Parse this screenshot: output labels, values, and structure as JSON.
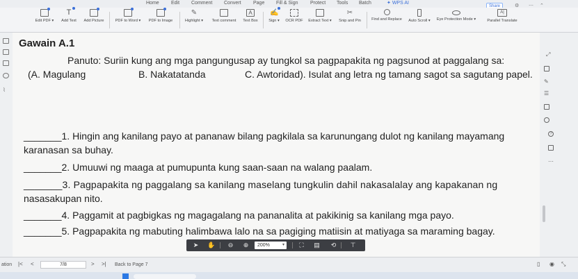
{
  "menu": {
    "tabs": [
      "Home",
      "Edit",
      "Comment",
      "Convert",
      "Page",
      "Fill & Sign",
      "Protect",
      "Tools",
      "Batch",
      "WPS AI"
    ],
    "share_label": "Share"
  },
  "ribbon": {
    "tools": [
      {
        "label": "Edit PDF ▾",
        "icon": "edit-pdf-icon"
      },
      {
        "label": "Add Text",
        "icon": "add-text-icon"
      },
      {
        "label": "Add Picture",
        "icon": "add-picture-icon"
      },
      {
        "label": "PDF to Word ▾",
        "icon": "pdf-to-word-icon"
      },
      {
        "label": "PDF to Image",
        "icon": "pdf-to-image-icon"
      },
      {
        "label": "Highlight ▾",
        "icon": "highlight-icon"
      },
      {
        "label": "Text comment",
        "icon": "text-comment-icon"
      },
      {
        "label": "Text Box",
        "icon": "text-box-icon"
      },
      {
        "label": "Sign ▾",
        "icon": "sign-icon"
      },
      {
        "label": "OCR PDF",
        "icon": "ocr-icon"
      },
      {
        "label": "Extract Text ▾",
        "icon": "extract-text-icon"
      },
      {
        "label": "Snip and Pin",
        "icon": "snip-icon"
      },
      {
        "label": "Find and Replace",
        "icon": "find-replace-icon"
      },
      {
        "label": "Auto Scroll ▾",
        "icon": "auto-scroll-icon"
      },
      {
        "label": "Eye Protection Mode ▾",
        "icon": "eye-icon"
      },
      {
        "label": "Parallel Translate",
        "icon": "translate-icon"
      }
    ]
  },
  "document": {
    "title": "Gawain A.1",
    "instruction_lead": "Panuto",
    "instruction_text": ": Suriin kung ang mga pangungusap ay tungkol sa pagpapakita ng pagsunod at paggalang sa:",
    "choice_a": "(A. Magulang",
    "choice_b": "B. Nakatatanda",
    "choice_c": "C. Awtoridad). Isulat ang letra ng tamang sagot sa sagutang papel.",
    "items": [
      {
        "line1": "_______1. Hingin ang kanilang payo at pananaw bilang pagkilala sa karunungang dulot ng kanilang mayamang",
        "line2": "karanasan sa buhay."
      },
      {
        "line1": "_______2. Umuuwi ng maaga at pumupunta kung saan-saan na walang paalam."
      },
      {
        "line1": "_______3.  Pagpapakita ng paggalang sa kanilang maselang tungkulin dahil nakasalalay ang kapakanan ng",
        "line2": "nasasakupan nito."
      },
      {
        "line1": "_______4. Paggamit at pagbigkas ng magagalang na pananalita at pakikinig sa kanilang mga payo."
      },
      {
        "line1": "_______5. Pagpapakita ng mabuting halimbawa lalo na sa pagiging matiisin at matiyaga sa maraming bagay."
      }
    ]
  },
  "viewbar": {
    "zoom": "200%"
  },
  "status": {
    "left_label": "ation",
    "page_indicator": "7/8",
    "back_label": "Back to Page 7"
  },
  "colors": {
    "accent": "#3b6fd8",
    "viewbar_bg": "#3c3e43",
    "page_bg": "#f7f7f6"
  }
}
